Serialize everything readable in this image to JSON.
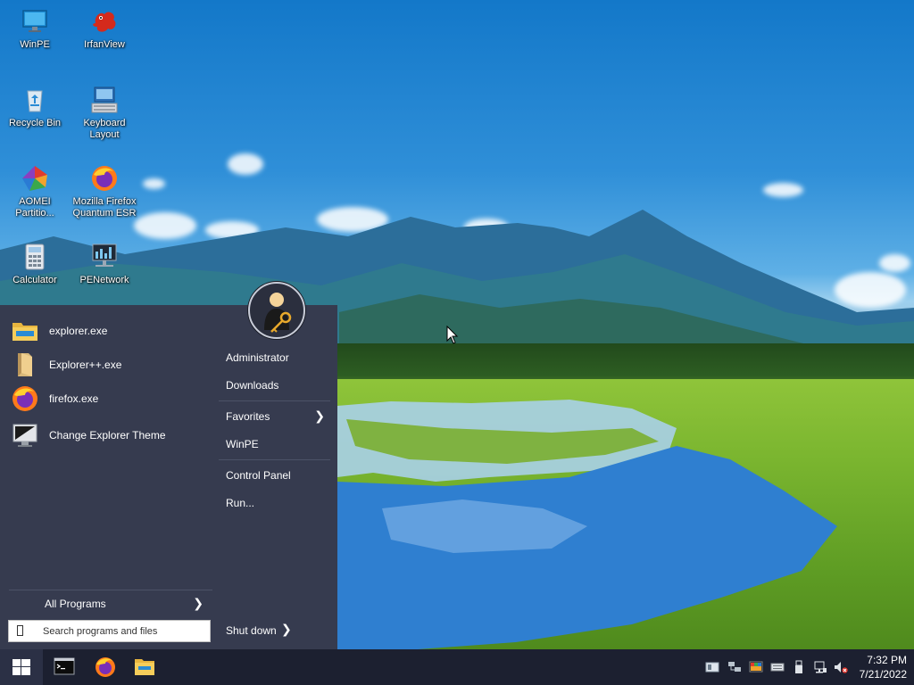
{
  "desktop": {
    "icons": [
      {
        "label": "WinPE"
      },
      {
        "label": "IrfanView"
      },
      {
        "label": "Recycle Bin"
      },
      {
        "label": "Keyboard Layout"
      },
      {
        "label": "AOMEI Partitio..."
      },
      {
        "label": "Mozilla Firefox Quantum ESR"
      },
      {
        "label": "Calculator"
      },
      {
        "label": "PENetwork"
      }
    ]
  },
  "start_menu": {
    "programs": [
      {
        "label": "explorer.exe",
        "icon": "folder-icon"
      },
      {
        "label": "Explorer++.exe",
        "icon": "folder-icon"
      },
      {
        "label": "firefox.exe",
        "icon": "firefox-icon"
      },
      {
        "label": "Change Explorer Theme",
        "icon": "monitor-icon"
      }
    ],
    "all_programs": "All Programs",
    "search_placeholder": "Search programs and files",
    "right_items": [
      {
        "label": "Administrator"
      },
      {
        "label": "Downloads"
      },
      {
        "label": "Favorites"
      },
      {
        "label": "WinPE"
      },
      {
        "label": "Control Panel"
      },
      {
        "label": "Run..."
      }
    ],
    "shutdown": "Shut down"
  },
  "taskbar": {
    "pinned": [
      {
        "name": "command-prompt-icon"
      },
      {
        "name": "firefox-icon"
      },
      {
        "name": "file-explorer-icon"
      }
    ],
    "clock": {
      "time": "7:32 PM",
      "date": "7/21/2022"
    }
  },
  "colors": {
    "start_menu_bg": "#363b4f",
    "taskbar_bg": "#1c2030",
    "accent": "#2b6fd6"
  }
}
